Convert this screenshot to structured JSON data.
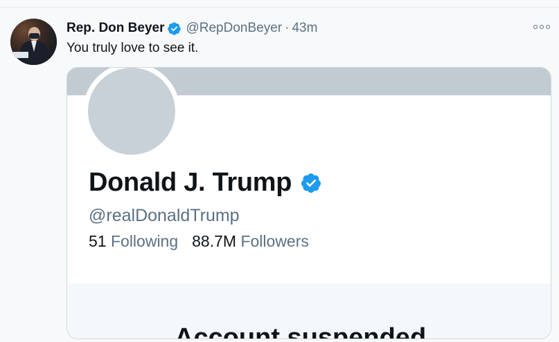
{
  "tweet": {
    "author_name": "Rep. Don Beyer",
    "author_handle": "@RepDonBeyer",
    "separator": "·",
    "time": "43m",
    "text": "You truly love to see it."
  },
  "embedded_profile": {
    "name": "Donald J. Trump",
    "handle": "@realDonaldTrump",
    "following_count": "51",
    "following_label": "Following",
    "followers_count": "88.7M",
    "followers_label": "Followers",
    "status_text": "Account suspended"
  },
  "colors": {
    "verified": "#1d9bf0",
    "secondary_text": "#5b7083",
    "banner": "#c3cbd2"
  },
  "icons": {
    "more": "more-horizontal-icon",
    "verified": "verified-badge-icon"
  }
}
